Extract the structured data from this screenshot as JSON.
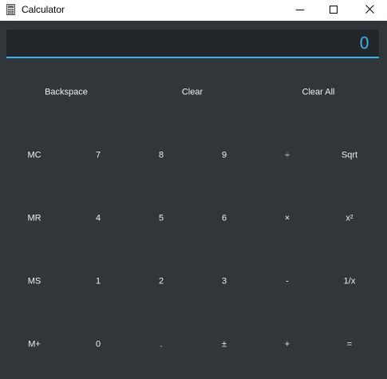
{
  "window": {
    "title": "Calculator"
  },
  "titlebar_icons": {
    "app": "calculator-icon",
    "minimize": "minimize-icon",
    "maximize": "maximize-icon",
    "close": "close-icon"
  },
  "display": {
    "value": "0"
  },
  "top_row": {
    "backspace": "Backspace",
    "clear": "Clear",
    "clear_all": "Clear All"
  },
  "keys": {
    "row1": [
      "MC",
      "7",
      "8",
      "9",
      "÷",
      "Sqrt"
    ],
    "row2": [
      "MR",
      "4",
      "5",
      "6",
      "×",
      "x²"
    ],
    "row3": [
      "MS",
      "1",
      "2",
      "3",
      "-",
      "1/x"
    ],
    "row4": [
      "M+",
      "0",
      ".",
      "±",
      "+",
      "="
    ]
  },
  "colors": {
    "background": "#31363b",
    "display_background": "#232629",
    "accent": "#3daee9",
    "text": "#eff0f1"
  }
}
